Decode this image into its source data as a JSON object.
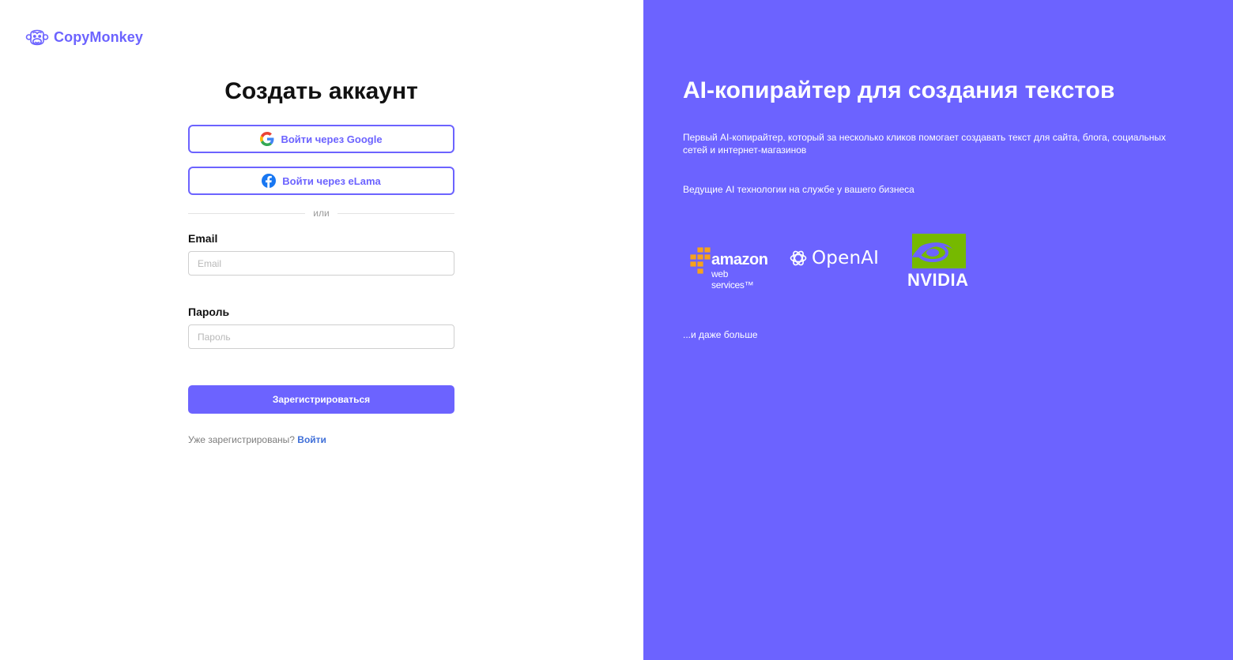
{
  "brand": {
    "name": "CopyMonkey",
    "color": "#6c63ff"
  },
  "form": {
    "title": "Создать аккаунт",
    "google_button": "Войти через Google",
    "elama_button": "Войти через eLama",
    "divider": "или",
    "email_label": "Email",
    "email_placeholder": "Email",
    "email_value": "",
    "password_label": "Пароль",
    "password_placeholder": "Пароль",
    "password_value": "",
    "submit_button": "Зарегистрироваться",
    "login_prompt": "Уже зарегистрированы?",
    "login_link": "Войти"
  },
  "promo": {
    "headline": "AI-копирайтер для создания текстов",
    "description": "Первый AI-копирайтер, который за несколько кликов помогает создавать текст для сайта, блога, социальных сетей и интернет-магазинов",
    "tagline": "Ведущие AI технологии на службе у вашего бизнеса",
    "more": "...и даже больше",
    "background_color": "#6c63ff",
    "partners": {
      "aws_word": "amazon",
      "aws_sub": "web services™",
      "openai": "OpenAI",
      "nvidia": "NVIDIA"
    }
  },
  "icons": {
    "logo": "monkey-icon",
    "google": "google-icon",
    "elama": "facebook-style-icon",
    "aws": "aws-cubes-icon",
    "openai": "openai-knot-icon",
    "nvidia": "nvidia-eye-icon"
  },
  "colors": {
    "aws_orange": "#f7a21b",
    "nvidia_green": "#76b900",
    "link_blue": "#3f6fd8"
  }
}
